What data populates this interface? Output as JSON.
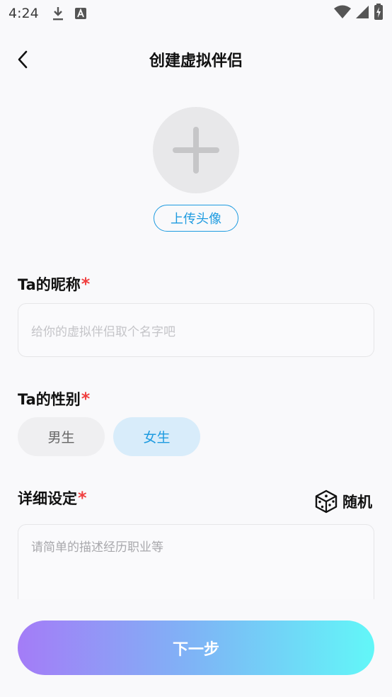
{
  "status_bar": {
    "time": "4:24",
    "left_icons": [
      "download-icon",
      "app-a-icon"
    ],
    "right_icons": [
      "wifi-icon",
      "signal-icon",
      "battery-charging-icon"
    ]
  },
  "header": {
    "title": "创建虚拟伴侣",
    "back_icon": "back-arrow-icon"
  },
  "avatar": {
    "icon": "plus-icon",
    "upload_label": "上传头像"
  },
  "nickname": {
    "label": "Ta的昵称",
    "required_mark": "*",
    "placeholder": "给你的虚拟伴侣取个名字吧"
  },
  "gender": {
    "label": "Ta的性别",
    "required_mark": "*",
    "options": [
      "男生",
      "女生"
    ],
    "selected": "女生"
  },
  "details": {
    "label": "详细设定",
    "required_mark": "*",
    "random_label": "随机",
    "random_icon": "dice-icon",
    "placeholder": "请简单的描述经历职业等"
  },
  "footer": {
    "next_label": "下一步"
  },
  "colors": {
    "accent": "#1e9be0",
    "required": "#f04040",
    "selected_bg": "#d8ecfa",
    "gradient_start": "#a47cf7",
    "gradient_end": "#62f7f8"
  }
}
